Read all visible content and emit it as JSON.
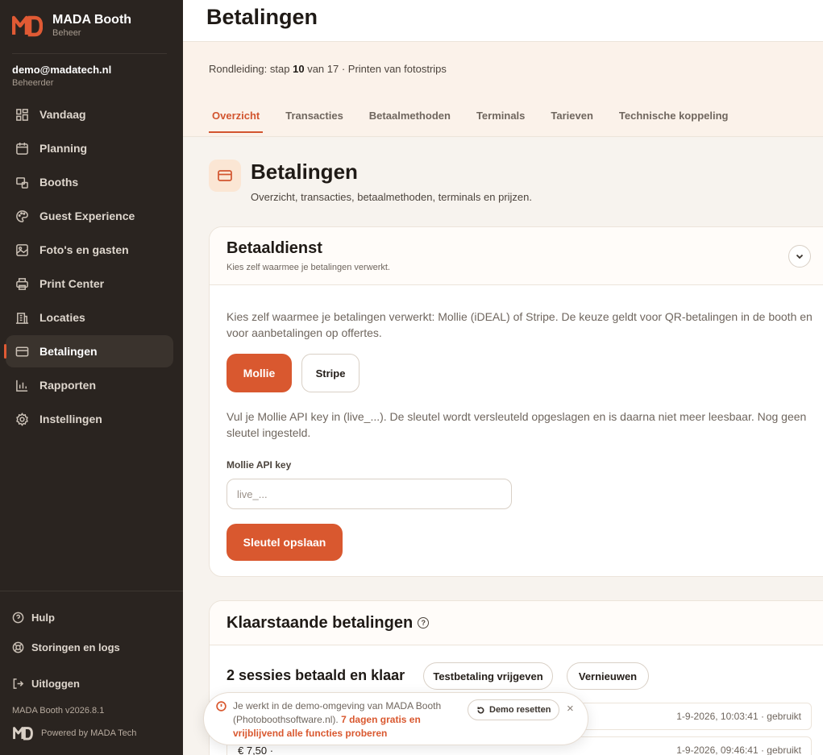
{
  "brand": {
    "name": "MADA Booth",
    "subtitle": "Beheer"
  },
  "user": {
    "email": "demo@madatech.nl",
    "role": "Beheerder"
  },
  "nav": [
    {
      "label": "Vandaag",
      "icon": "dashboard-icon"
    },
    {
      "label": "Planning",
      "icon": "calendar-icon"
    },
    {
      "label": "Booths",
      "icon": "booth-icon"
    },
    {
      "label": "Guest Experience",
      "icon": "palette-icon"
    },
    {
      "label": "Foto's en gasten",
      "icon": "image-icon"
    },
    {
      "label": "Print Center",
      "icon": "printer-icon"
    },
    {
      "label": "Locaties",
      "icon": "building-icon"
    },
    {
      "label": "Betalingen",
      "icon": "credit-card-icon",
      "active": true
    },
    {
      "label": "Rapporten",
      "icon": "bar-chart-icon"
    },
    {
      "label": "Instellingen",
      "icon": "gear-icon"
    }
  ],
  "sidebar_footer": {
    "help": "Hulp",
    "logs": "Storingen en logs",
    "logout": "Uitloggen",
    "version": "MADA Booth v2026.8.1",
    "powered": "Powered by MADA Tech"
  },
  "header": {
    "title": "Betalingen"
  },
  "tour": {
    "prefix": "Rondleiding: stap",
    "step": "10",
    "rest": "van 17 · Printen van fotostrips"
  },
  "tabs": [
    {
      "label": "Overzicht",
      "active": true
    },
    {
      "label": "Transacties"
    },
    {
      "label": "Betaalmethoden"
    },
    {
      "label": "Terminals"
    },
    {
      "label": "Tarieven"
    },
    {
      "label": "Technische koppeling"
    }
  ],
  "page": {
    "title": "Betalingen",
    "subtitle": "Overzicht, transacties, betaalmethoden, terminals en prijzen."
  },
  "payment_service": {
    "title": "Betaaldienst",
    "subtitle": "Kies zelf waarmee je betalingen verwerkt.",
    "description": "Kies zelf waarmee je betalingen verwerkt: Mollie (iDEAL) of Stripe. De keuze geldt voor QR-betalingen in de booth en voor aanbetalingen op offertes.",
    "providers": [
      "Mollie",
      "Stripe"
    ],
    "selected_provider": "Mollie",
    "key_info": "Vul je Mollie API key in (live_...). De sleutel wordt versleuteld opgeslagen en is daarna niet meer leesbaar. Nog geen sleutel ingesteld.",
    "field_label": "Mollie API key",
    "field_placeholder": "live_...",
    "field_value": "",
    "save_label": "Sleutel opslaan"
  },
  "pending": {
    "title": "Klaarstaande betalingen",
    "help_glyph": "?",
    "count_title": "2 sessies betaald en klaar",
    "release_label": "Testbetaling vrijgeven",
    "refresh_label": "Vernieuwen",
    "rows": [
      {
        "amount": "",
        "meta": "1-9-2026, 10:03:41 · gebruikt"
      },
      {
        "amount": "€ 7,50 ·",
        "meta": "1-9-2026, 09:46:41 · gebruikt"
      }
    ]
  },
  "toast": {
    "text": "Je werkt in de demo-omgeving van MADA Booth (Photoboothsoftware.nl).",
    "link": "7 dagen gratis en vrijblijvend alle functies proberen",
    "reset_label": "Demo resetten",
    "close_glyph": "×"
  },
  "colors": {
    "accent": "#d9582f",
    "sidebar": "#2a2420",
    "background": "#f7f3ee"
  }
}
